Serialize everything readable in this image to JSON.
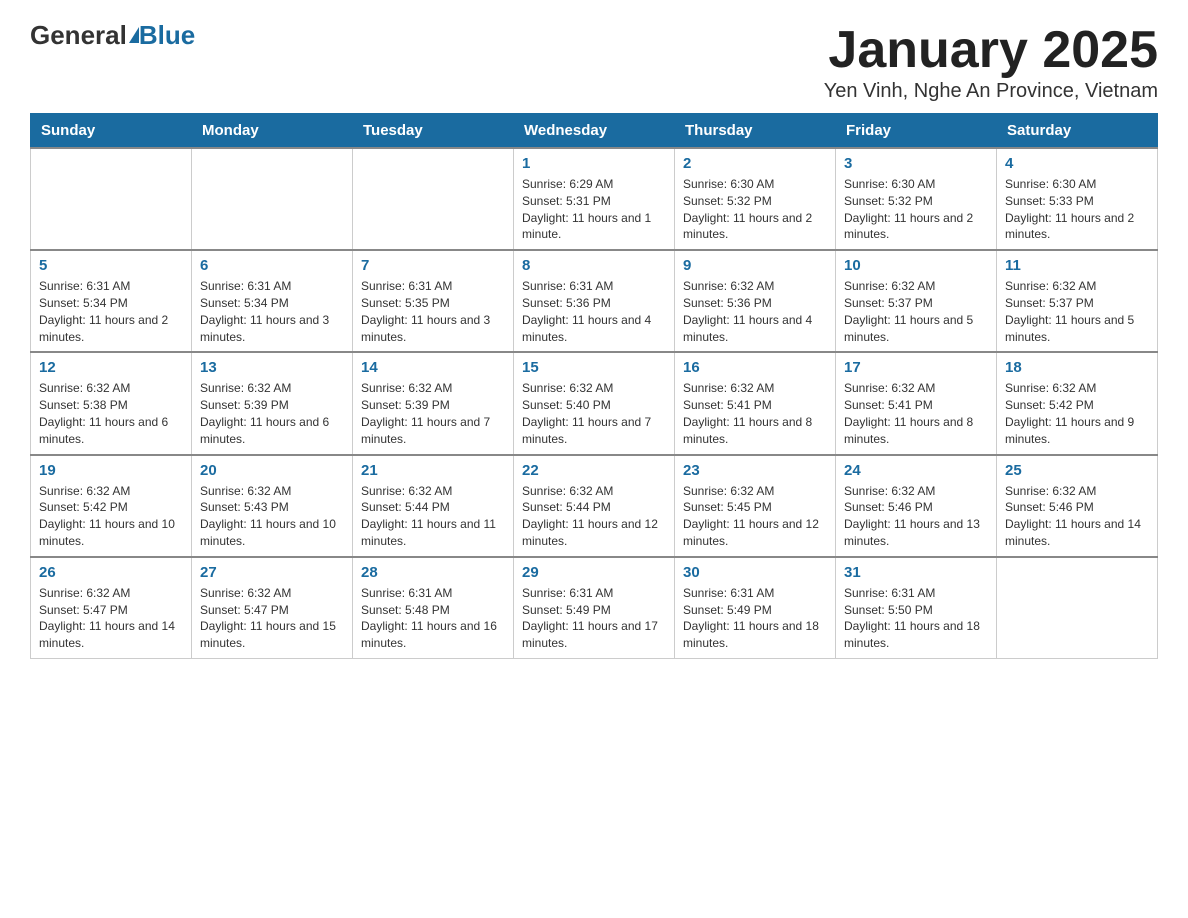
{
  "header": {
    "logo_general": "General",
    "logo_blue": "Blue",
    "month_title": "January 2025",
    "location": "Yen Vinh, Nghe An Province, Vietnam"
  },
  "weekdays": [
    "Sunday",
    "Monday",
    "Tuesday",
    "Wednesday",
    "Thursday",
    "Friday",
    "Saturday"
  ],
  "weeks": [
    [
      {
        "day": "",
        "info": ""
      },
      {
        "day": "",
        "info": ""
      },
      {
        "day": "",
        "info": ""
      },
      {
        "day": "1",
        "info": "Sunrise: 6:29 AM\nSunset: 5:31 PM\nDaylight: 11 hours and 1 minute."
      },
      {
        "day": "2",
        "info": "Sunrise: 6:30 AM\nSunset: 5:32 PM\nDaylight: 11 hours and 2 minutes."
      },
      {
        "day": "3",
        "info": "Sunrise: 6:30 AM\nSunset: 5:32 PM\nDaylight: 11 hours and 2 minutes."
      },
      {
        "day": "4",
        "info": "Sunrise: 6:30 AM\nSunset: 5:33 PM\nDaylight: 11 hours and 2 minutes."
      }
    ],
    [
      {
        "day": "5",
        "info": "Sunrise: 6:31 AM\nSunset: 5:34 PM\nDaylight: 11 hours and 2 minutes."
      },
      {
        "day": "6",
        "info": "Sunrise: 6:31 AM\nSunset: 5:34 PM\nDaylight: 11 hours and 3 minutes."
      },
      {
        "day": "7",
        "info": "Sunrise: 6:31 AM\nSunset: 5:35 PM\nDaylight: 11 hours and 3 minutes."
      },
      {
        "day": "8",
        "info": "Sunrise: 6:31 AM\nSunset: 5:36 PM\nDaylight: 11 hours and 4 minutes."
      },
      {
        "day": "9",
        "info": "Sunrise: 6:32 AM\nSunset: 5:36 PM\nDaylight: 11 hours and 4 minutes."
      },
      {
        "day": "10",
        "info": "Sunrise: 6:32 AM\nSunset: 5:37 PM\nDaylight: 11 hours and 5 minutes."
      },
      {
        "day": "11",
        "info": "Sunrise: 6:32 AM\nSunset: 5:37 PM\nDaylight: 11 hours and 5 minutes."
      }
    ],
    [
      {
        "day": "12",
        "info": "Sunrise: 6:32 AM\nSunset: 5:38 PM\nDaylight: 11 hours and 6 minutes."
      },
      {
        "day": "13",
        "info": "Sunrise: 6:32 AM\nSunset: 5:39 PM\nDaylight: 11 hours and 6 minutes."
      },
      {
        "day": "14",
        "info": "Sunrise: 6:32 AM\nSunset: 5:39 PM\nDaylight: 11 hours and 7 minutes."
      },
      {
        "day": "15",
        "info": "Sunrise: 6:32 AM\nSunset: 5:40 PM\nDaylight: 11 hours and 7 minutes."
      },
      {
        "day": "16",
        "info": "Sunrise: 6:32 AM\nSunset: 5:41 PM\nDaylight: 11 hours and 8 minutes."
      },
      {
        "day": "17",
        "info": "Sunrise: 6:32 AM\nSunset: 5:41 PM\nDaylight: 11 hours and 8 minutes."
      },
      {
        "day": "18",
        "info": "Sunrise: 6:32 AM\nSunset: 5:42 PM\nDaylight: 11 hours and 9 minutes."
      }
    ],
    [
      {
        "day": "19",
        "info": "Sunrise: 6:32 AM\nSunset: 5:42 PM\nDaylight: 11 hours and 10 minutes."
      },
      {
        "day": "20",
        "info": "Sunrise: 6:32 AM\nSunset: 5:43 PM\nDaylight: 11 hours and 10 minutes."
      },
      {
        "day": "21",
        "info": "Sunrise: 6:32 AM\nSunset: 5:44 PM\nDaylight: 11 hours and 11 minutes."
      },
      {
        "day": "22",
        "info": "Sunrise: 6:32 AM\nSunset: 5:44 PM\nDaylight: 11 hours and 12 minutes."
      },
      {
        "day": "23",
        "info": "Sunrise: 6:32 AM\nSunset: 5:45 PM\nDaylight: 11 hours and 12 minutes."
      },
      {
        "day": "24",
        "info": "Sunrise: 6:32 AM\nSunset: 5:46 PM\nDaylight: 11 hours and 13 minutes."
      },
      {
        "day": "25",
        "info": "Sunrise: 6:32 AM\nSunset: 5:46 PM\nDaylight: 11 hours and 14 minutes."
      }
    ],
    [
      {
        "day": "26",
        "info": "Sunrise: 6:32 AM\nSunset: 5:47 PM\nDaylight: 11 hours and 14 minutes."
      },
      {
        "day": "27",
        "info": "Sunrise: 6:32 AM\nSunset: 5:47 PM\nDaylight: 11 hours and 15 minutes."
      },
      {
        "day": "28",
        "info": "Sunrise: 6:31 AM\nSunset: 5:48 PM\nDaylight: 11 hours and 16 minutes."
      },
      {
        "day": "29",
        "info": "Sunrise: 6:31 AM\nSunset: 5:49 PM\nDaylight: 11 hours and 17 minutes."
      },
      {
        "day": "30",
        "info": "Sunrise: 6:31 AM\nSunset: 5:49 PM\nDaylight: 11 hours and 18 minutes."
      },
      {
        "day": "31",
        "info": "Sunrise: 6:31 AM\nSunset: 5:50 PM\nDaylight: 11 hours and 18 minutes."
      },
      {
        "day": "",
        "info": ""
      }
    ]
  ]
}
